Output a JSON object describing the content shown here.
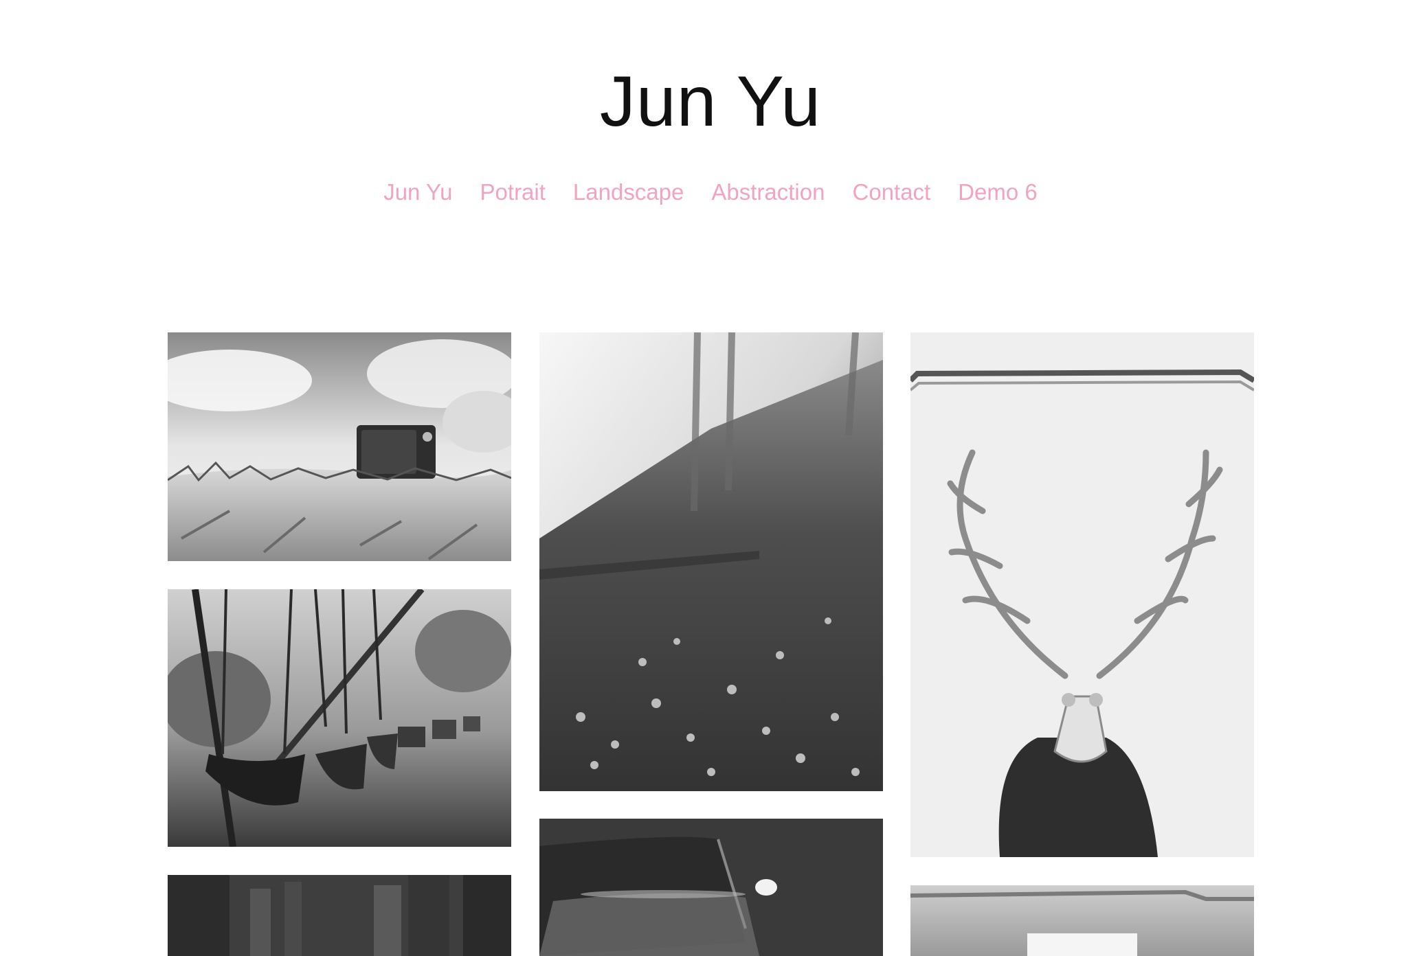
{
  "site": {
    "title": "Jun Yu"
  },
  "nav": {
    "items": [
      {
        "label": "Jun Yu"
      },
      {
        "label": "Potrait"
      },
      {
        "label": "Landscape"
      },
      {
        "label": "Abstraction"
      },
      {
        "label": "Contact"
      },
      {
        "label": "Demo 6"
      }
    ]
  },
  "colors": {
    "nav_link": "#f2a3c0",
    "title": "#111111",
    "background": "#ffffff"
  },
  "gallery": {
    "images": [
      {
        "name": "tv-on-dune"
      },
      {
        "name": "playground-swings"
      },
      {
        "name": "dark-hallway"
      },
      {
        "name": "foggy-forest"
      },
      {
        "name": "car-at-night"
      },
      {
        "name": "deer-skull-figure"
      },
      {
        "name": "bright-interior"
      }
    ]
  }
}
